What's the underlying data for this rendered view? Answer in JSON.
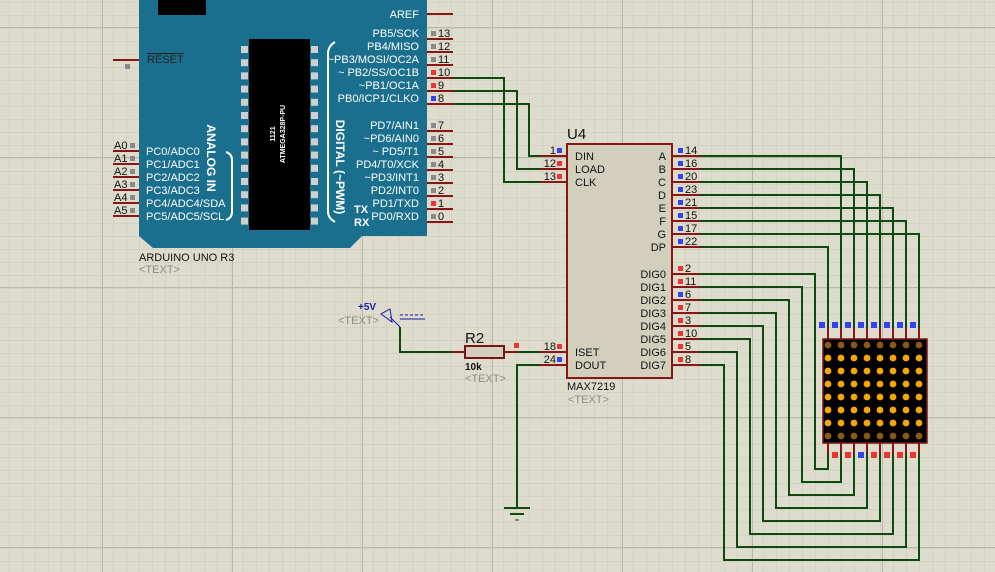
{
  "arduino": {
    "name": "ARDUINO UNO R3",
    "text_placeholder": "<TEXT>",
    "chip_line1": "1121",
    "chip_line2": "ATMEGA328P-PU",
    "analog_label": "ANALOG IN",
    "digital_label": "DIGITAL (~PWM)",
    "reset_label": "RESET",
    "aref_label": "AREF",
    "tx_label": "TX",
    "rx_label": "RX",
    "right_pins": [
      {
        "label": "PB5/SCK",
        "num": "13",
        "state": "floating"
      },
      {
        "label": "PB4/MISO",
        "num": "12",
        "state": "floating"
      },
      {
        "label": "~PB3/MOSI/OC2A",
        "num": "11",
        "state": "floating"
      },
      {
        "label": "~ PB2/SS/OC1B",
        "num": "10",
        "state": "high"
      },
      {
        "label": "~PB1/OC1A",
        "num": "9",
        "state": "high"
      },
      {
        "label": "PB0/ICP1/CLKO",
        "num": "8",
        "state": "low"
      },
      {
        "label": "PD7/AIN1",
        "num": "7",
        "state": "floating"
      },
      {
        "label": "~PD6/AIN0",
        "num": "6",
        "state": "floating"
      },
      {
        "label": "~      PD5/T1",
        "num": "5",
        "state": "floating"
      },
      {
        "label": "PD4/T0/XCK",
        "num": "4",
        "state": "floating"
      },
      {
        "label": "~PD3/INT1",
        "num": "3",
        "state": "floating"
      },
      {
        "label": "PD2/INT0",
        "num": "2",
        "state": "floating"
      },
      {
        "label": "PD1/TXD",
        "num": "1",
        "state": "high"
      },
      {
        "label": "PD0/RXD",
        "num": "0",
        "state": "floating"
      }
    ],
    "left_pins": [
      {
        "name": "A0",
        "label": "PC0/ADC0"
      },
      {
        "name": "A1",
        "label": "PC1/ADC1"
      },
      {
        "name": "A2",
        "label": "PC2/ADC2"
      },
      {
        "name": "A3",
        "label": "PC3/ADC3"
      },
      {
        "name": "A4",
        "label": "PC4/ADC4/SDA"
      },
      {
        "name": "A5",
        "label": "PC5/ADC5/SCL"
      }
    ]
  },
  "max7219": {
    "ref": "U4",
    "part": "MAX7219",
    "text_placeholder": "<TEXT>",
    "left_pins": [
      {
        "label": "DIN",
        "num": "1",
        "state": "low"
      },
      {
        "label": "LOAD",
        "num": "12",
        "state": "high"
      },
      {
        "label": "CLK",
        "num": "13",
        "state": "high"
      },
      {
        "label": "ISET",
        "num": "18",
        "state": "high"
      },
      {
        "label": "DOUT",
        "num": "24",
        "state": "low"
      }
    ],
    "segment_pins": [
      {
        "label": "A",
        "num": "14",
        "state": "low"
      },
      {
        "label": "B",
        "num": "16",
        "state": "low"
      },
      {
        "label": "C",
        "num": "20",
        "state": "low"
      },
      {
        "label": "D",
        "num": "23",
        "state": "low"
      },
      {
        "label": "E",
        "num": "21",
        "state": "low"
      },
      {
        "label": "F",
        "num": "15",
        "state": "low"
      },
      {
        "label": "G",
        "num": "17",
        "state": "low"
      },
      {
        "label": "DP",
        "num": "22",
        "state": "low"
      }
    ],
    "digit_pins": [
      {
        "label": "DIG0",
        "num": "2",
        "state": "high"
      },
      {
        "label": "DIG1",
        "num": "11",
        "state": "high"
      },
      {
        "label": "DIG2",
        "num": "6",
        "state": "low"
      },
      {
        "label": "DIG3",
        "num": "7",
        "state": "high"
      },
      {
        "label": "DIG4",
        "num": "3",
        "state": "high"
      },
      {
        "label": "DIG5",
        "num": "10",
        "state": "high"
      },
      {
        "label": "DIG6",
        "num": "5",
        "state": "high"
      },
      {
        "label": "DIG7",
        "num": "8",
        "state": "high"
      }
    ]
  },
  "resistor": {
    "ref": "R2",
    "value": "10k",
    "text_placeholder": "<TEXT>"
  },
  "power": {
    "label": "+5V",
    "text_placeholder": "<TEXT>"
  },
  "matrix": {
    "rows": 8,
    "cols": 8,
    "lit_rows": [
      false,
      true,
      true,
      true,
      true,
      true,
      true,
      false
    ],
    "top_pin_states": [
      "low",
      "low",
      "low",
      "low",
      "low",
      "low",
      "low",
      "low"
    ],
    "bottom_pin_states": [
      "high",
      "high",
      "low",
      "high",
      "high",
      "high",
      "high"
    ]
  },
  "colors": {
    "background": "#dddccd",
    "grid_minor": "#cac9ba",
    "grid_major": "#b9b8a9",
    "wire": "#0d4a0d",
    "pin_line": "#8b1515",
    "arduino_board": "#1b6f8e",
    "chip_body": "#d2d0bd",
    "state_high": "#ee3333",
    "state_low": "#3344ee",
    "state_floating": "#8a8a8a",
    "led_on": "#f7a800",
    "led_off": "#8a5a14",
    "power_blue": "#1a1aa8"
  }
}
